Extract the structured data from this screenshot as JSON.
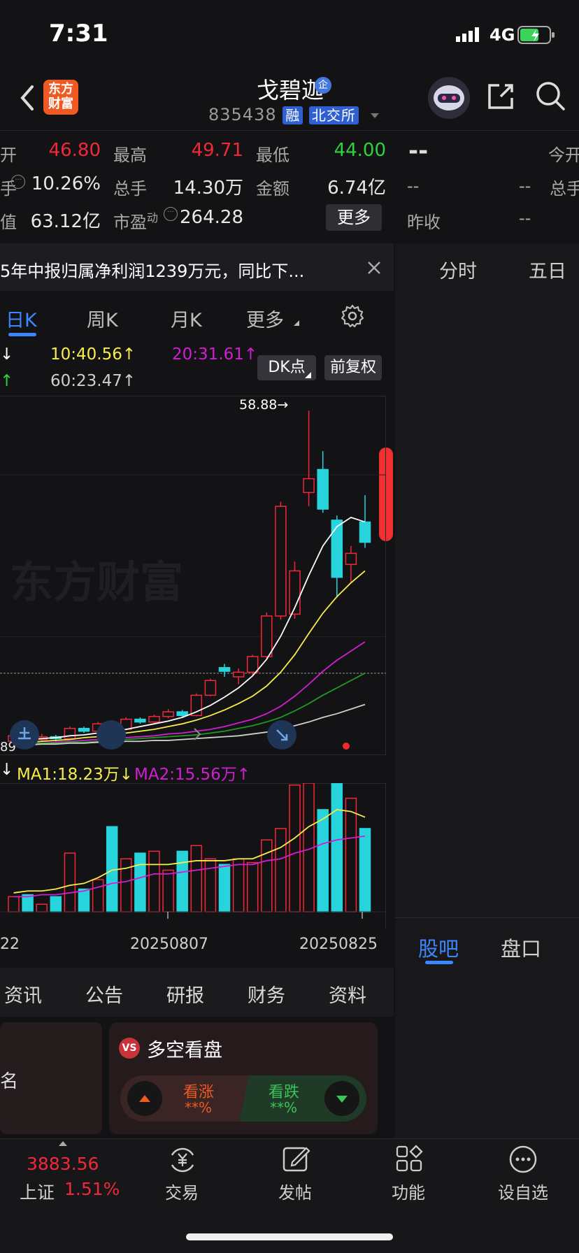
{
  "status_bar": {
    "time": "7:31",
    "network": "4G"
  },
  "header": {
    "logo_line1": "东方",
    "logo_line2": "财富",
    "stock_name": "戈碧迦",
    "badge": "企",
    "stock_code": "835438",
    "tag_margin": "融",
    "tag_exchange": "北交所"
  },
  "quote": {
    "open_label": "开",
    "open_value": "46.80",
    "high_label": "最高",
    "high_value": "49.71",
    "low_label": "最低",
    "low_value": "44.00",
    "turnover_label": "手",
    "turnover_value": "10.26%",
    "volume_label": "总手",
    "volume_value": "14.30万",
    "amount_label": "金额",
    "amount_value": "6.74亿",
    "mktcap_label": "值",
    "mktcap_value": "63.12亿",
    "pe_label": "市盈",
    "pe_sup": "动",
    "pe_value": "264.28",
    "more_label": "更多"
  },
  "side_quote": {
    "placeholder": "--",
    "dash1": "--",
    "dash2": "--",
    "dash3": "--",
    "today_open_label": "今开",
    "total_label": "总手",
    "prev_close_label": "昨收",
    "prev_close_value": "--"
  },
  "news": {
    "text": "5年中报归属净利润1239万元，同比下..."
  },
  "right_tabs": {
    "intraday": "分时",
    "five_day": "五日",
    "guba": "股吧",
    "pankou": "盘口"
  },
  "k_tabs": {
    "day": "日K",
    "week": "周K",
    "month": "月K",
    "more": "更多"
  },
  "ma_line1": {
    "arrow_left": "↓",
    "ma10": "10:40.56↑",
    "ma20": "20:31.61↑",
    "dk": "DK点",
    "fq": "前复权"
  },
  "ma_line2": {
    "arrow_left": "↑",
    "ma60": "60:23.47↑"
  },
  "chart_annotations": {
    "max_price": "58.88",
    "left_price": "89",
    "watermark": "东方财富"
  },
  "vol_legend": {
    "arrow_left": "↓",
    "ma1": "MA1:18.23万↓",
    "ma2": "MA2:15.56万↑"
  },
  "x_axis": {
    "label_left": "22",
    "label_mid": "20250807",
    "label_right": "20250825"
  },
  "info_tabs": [
    "资讯",
    "公告",
    "研报",
    "财务",
    "资料"
  ],
  "cards": {
    "left_text": "名",
    "vs_badge": "VS",
    "vs_title": "多空看盘",
    "bull_label": "看涨",
    "bull_value": "**%",
    "bear_label": "看跌",
    "bear_value": "**%"
  },
  "nav": {
    "index_value": "3883.56",
    "index_name": "上证",
    "index_change": "1.51%",
    "trade": "交易",
    "post": "发帖",
    "func": "功能",
    "watch": "设自选"
  },
  "colors": {
    "up": "#f2283a",
    "down": "#27d4dc",
    "accent": "#3a87ff",
    "ma_white": "#ffffff",
    "ma_yellow": "#f7ee4a",
    "ma_magenta": "#d21ed2",
    "ma_green": "#1f9a1f"
  },
  "chart_data": {
    "type": "candlestick",
    "candles": [
      {
        "o": 23.0,
        "c": 23.6,
        "h": 23.9,
        "l": 22.8
      },
      {
        "o": 23.6,
        "c": 23.2,
        "h": 23.9,
        "l": 22.9
      },
      {
        "o": 23.2,
        "c": 23.5,
        "h": 23.8,
        "l": 23.0
      },
      {
        "o": 23.5,
        "c": 23.3,
        "h": 23.7,
        "l": 23.0
      },
      {
        "o": 23.3,
        "c": 24.4,
        "h": 24.6,
        "l": 23.2
      },
      {
        "o": 24.4,
        "c": 24.1,
        "h": 24.6,
        "l": 23.9
      },
      {
        "o": 24.1,
        "c": 24.9,
        "h": 25.1,
        "l": 24.0
      },
      {
        "o": 24.9,
        "c": 24.3,
        "h": 25.1,
        "l": 24.1
      },
      {
        "o": 24.3,
        "c": 25.4,
        "h": 25.6,
        "l": 24.2
      },
      {
        "o": 25.4,
        "c": 25.1,
        "h": 25.6,
        "l": 24.9
      },
      {
        "o": 25.1,
        "c": 25.7,
        "h": 25.9,
        "l": 25.0
      },
      {
        "o": 25.7,
        "c": 26.2,
        "h": 26.5,
        "l": 25.5
      },
      {
        "o": 26.2,
        "c": 25.8,
        "h": 26.4,
        "l": 25.6
      },
      {
        "o": 25.8,
        "c": 28.0,
        "h": 28.2,
        "l": 25.7
      },
      {
        "o": 28.0,
        "c": 29.6,
        "h": 29.8,
        "l": 27.9
      },
      {
        "o": 31.0,
        "c": 30.6,
        "h": 31.4,
        "l": 30.0
      },
      {
        "o": 30.0,
        "c": 30.5,
        "h": 30.9,
        "l": 29.2
      },
      {
        "o": 30.5,
        "c": 32.2,
        "h": 32.4,
        "l": 30.2
      },
      {
        "o": 32.2,
        "c": 36.6,
        "h": 37.0,
        "l": 32.0
      },
      {
        "o": 36.6,
        "c": 48.5,
        "h": 49.0,
        "l": 36.2
      },
      {
        "o": 36.8,
        "c": 41.5,
        "h": 42.5,
        "l": 36.3
      },
      {
        "o": 50.0,
        "c": 51.5,
        "h": 58.88,
        "l": 48.5
      },
      {
        "o": 52.5,
        "c": 48.2,
        "h": 54.5,
        "l": 47.8
      },
      {
        "o": 47.0,
        "c": 40.8,
        "h": 47.5,
        "l": 38.6
      },
      {
        "o": 42.2,
        "c": 43.4,
        "h": 44.2,
        "l": 40.2
      },
      {
        "o": 46.8,
        "c": 44.6,
        "h": 49.71,
        "l": 44.0
      }
    ],
    "volumes": [
      8,
      9,
      4,
      8,
      31,
      12,
      17,
      45,
      28,
      31,
      32,
      22,
      32,
      35,
      28,
      25,
      28,
      26,
      38,
      44,
      67,
      68,
      54,
      68,
      60,
      44
    ],
    "ma_price": {
      "white": [
        23.1,
        23.2,
        23.3,
        23.4,
        23.6,
        23.7,
        23.9,
        24.1,
        24.3,
        24.6,
        24.9,
        25.2,
        25.6,
        26.2,
        26.9,
        27.8,
        28.8,
        30.1,
        31.9,
        34.4,
        37.5,
        41.0,
        44.2,
        46.3,
        47.3,
        46.8
      ],
      "yellow": [
        22.8,
        22.9,
        23.0,
        23.1,
        23.2,
        23.4,
        23.5,
        23.7,
        23.9,
        24.1,
        24.3,
        24.6,
        24.9,
        25.3,
        25.8,
        26.4,
        27.1,
        27.9,
        29.0,
        30.5,
        32.4,
        34.7,
        36.9,
        38.7,
        40.2,
        41.5
      ],
      "magenta": [
        22.7,
        22.8,
        22.8,
        22.9,
        23.0,
        23.1,
        23.2,
        23.3,
        23.4,
        23.5,
        23.6,
        23.8,
        23.9,
        24.1,
        24.3,
        24.6,
        25.0,
        25.4,
        26.0,
        26.8,
        27.9,
        29.2,
        30.6,
        31.8,
        32.8,
        33.8
      ],
      "green": [
        22.7,
        22.7,
        22.8,
        22.8,
        22.9,
        22.9,
        23.0,
        23.1,
        23.2,
        23.3,
        23.4,
        23.5,
        23.6,
        23.7,
        23.9,
        24.1,
        24.4,
        24.7,
        25.1,
        25.6,
        26.3,
        27.1,
        28.0,
        28.8,
        29.6,
        30.4
      ],
      "gray": [
        22.6,
        22.6,
        22.7,
        22.7,
        22.8,
        22.8,
        22.9,
        22.9,
        23.0,
        23.0,
        23.1,
        23.1,
        23.2,
        23.3,
        23.4,
        23.5,
        23.6,
        23.8,
        24.0,
        24.3,
        24.7,
        25.1,
        25.6,
        26.0,
        26.5,
        27.0
      ]
    },
    "ma_volume": {
      "yellow": [
        10,
        11,
        11,
        12,
        14,
        15,
        18,
        22,
        23,
        25,
        25,
        25,
        26,
        27,
        27,
        27,
        28,
        28,
        31,
        34,
        39,
        45,
        49,
        54,
        53,
        50
      ],
      "magenta": [
        8,
        8,
        9,
        9,
        10,
        11,
        13,
        15,
        16,
        18,
        20,
        20,
        21,
        22,
        23,
        24,
        25,
        25,
        27,
        28,
        31,
        33,
        36,
        38,
        39,
        40
      ]
    }
  }
}
